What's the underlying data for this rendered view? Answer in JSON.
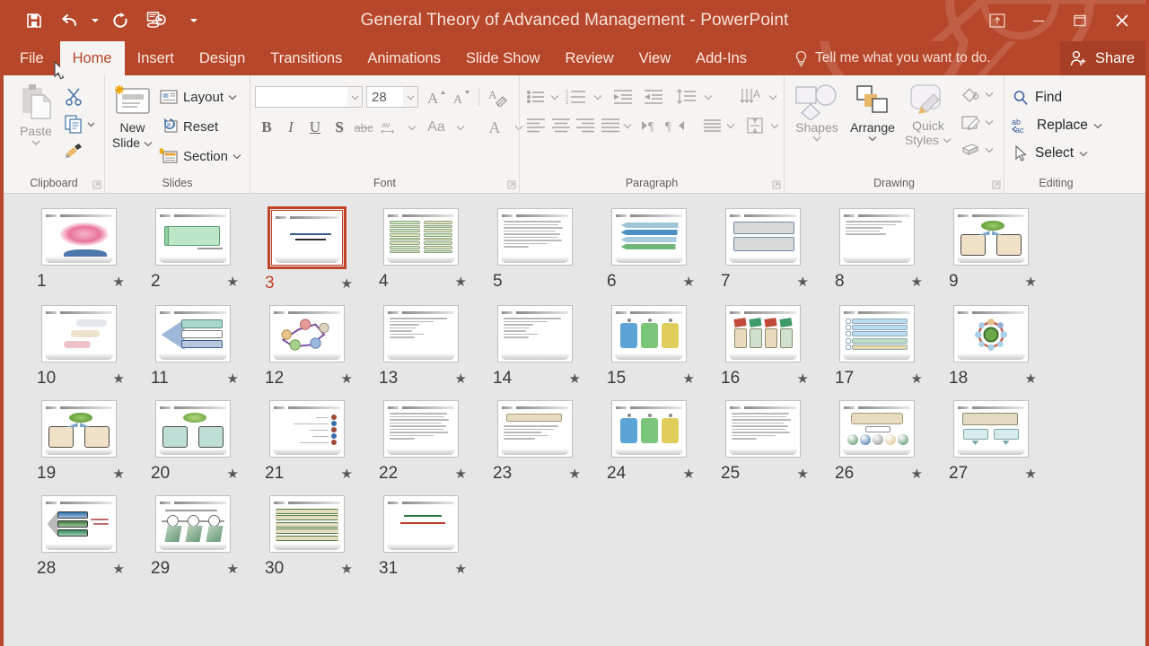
{
  "window": {
    "title": "General Theory of Advanced Management - PowerPoint",
    "accent_color": "#b7472a",
    "ribbon_bg": "#f5f4f2",
    "selection_color": "#c0442a"
  },
  "quick_access": [
    {
      "name": "save-icon",
      "label": "Save"
    },
    {
      "name": "undo-icon",
      "label": "Undo"
    },
    {
      "name": "redo-icon",
      "label": "Redo"
    },
    {
      "name": "start-presentation-icon",
      "label": "Start From Beginning"
    },
    {
      "name": "customize-qat-icon",
      "label": "Customize Quick Access Toolbar"
    }
  ],
  "window_controls": [
    {
      "name": "ribbon-display-options-icon",
      "label": "Ribbon Display Options"
    },
    {
      "name": "minimize-icon",
      "label": "Minimize"
    },
    {
      "name": "restore-icon",
      "label": "Restore Down"
    },
    {
      "name": "close-icon",
      "label": "Close"
    }
  ],
  "tabs": [
    {
      "label": "File",
      "active": false
    },
    {
      "label": "Home",
      "active": true
    },
    {
      "label": "Insert",
      "active": false
    },
    {
      "label": "Design",
      "active": false
    },
    {
      "label": "Transitions",
      "active": false
    },
    {
      "label": "Animations",
      "active": false
    },
    {
      "label": "Slide Show",
      "active": false
    },
    {
      "label": "Review",
      "active": false
    },
    {
      "label": "View",
      "active": false
    },
    {
      "label": "Add-Ins",
      "active": false
    }
  ],
  "tellme": {
    "placeholder": "Tell me what you want to do."
  },
  "share": {
    "label": "Share"
  },
  "ribbon": {
    "clipboard": {
      "group_label": "Clipboard",
      "paste_label": "Paste",
      "cut_label": "Cut",
      "copy_label": "Copy",
      "format_painter_label": "Format Painter"
    },
    "slides": {
      "group_label": "Slides",
      "new_slide_line1": "New",
      "new_slide_line2": "Slide",
      "layout_label": "Layout",
      "reset_label": "Reset",
      "section_label": "Section"
    },
    "font": {
      "group_label": "Font",
      "font_name_value": "",
      "font_size_value": "28",
      "bold_label": "B",
      "italic_label": "I",
      "underline_label": "U",
      "shadow_label": "S",
      "strikethrough_label": "abc",
      "spacing_label": "AV",
      "change_case_label": "Aa",
      "font_color_label": "A",
      "clear_formatting_label": "Clear All Formatting"
    },
    "paragraph": {
      "group_label": "Paragraph",
      "bullets_label": "Bullets",
      "numbering_label": "Numbering",
      "decrease_indent_label": "Decrease List Level",
      "increase_indent_label": "Increase List Level",
      "line_spacing_label": "Line Spacing",
      "align_left_label": "Align Left",
      "center_label": "Center",
      "align_right_label": "Align Right",
      "justify_label": "Justify",
      "ltr_label": "Left-to-Right",
      "rtl_label": "Right-to-Left",
      "columns_label": "Columns",
      "text_direction_label": "Text Direction",
      "align_text_label": "Align Text",
      "smartart_label": "Convert to SmartArt"
    },
    "drawing": {
      "group_label": "Drawing",
      "shapes_label": "Shapes",
      "arrange_label": "Arrange",
      "quick_styles_line1": "Quick",
      "quick_styles_line2": "Styles",
      "shape_fill_label": "Shape Fill",
      "shape_outline_label": "Shape Outline",
      "shape_effects_label": "Shape Effects"
    },
    "editing": {
      "group_label": "Editing",
      "find_label": "Find",
      "replace_label": "Replace",
      "select_label": "Select"
    }
  },
  "sorter": {
    "selected_slide": 3,
    "slides": [
      {
        "n": "1",
        "star": true,
        "kind": "calligraphy"
      },
      {
        "n": "2",
        "star": true,
        "kind": "green-banner"
      },
      {
        "n": "3",
        "star": true,
        "kind": "title-only",
        "selected": true
      },
      {
        "n": "4",
        "star": true,
        "kind": "two-tables"
      },
      {
        "n": "5",
        "star": false,
        "kind": "text-para"
      },
      {
        "n": "6",
        "star": true,
        "kind": "arrows-stack"
      },
      {
        "n": "7",
        "star": true,
        "kind": "two-boxes"
      },
      {
        "n": "8",
        "star": true,
        "kind": "text-lines"
      },
      {
        "n": "9",
        "star": true,
        "kind": "green-oval-two"
      },
      {
        "n": "10",
        "star": true,
        "kind": "pills"
      },
      {
        "n": "11",
        "star": true,
        "kind": "big-arrow"
      },
      {
        "n": "12",
        "star": true,
        "kind": "network"
      },
      {
        "n": "13",
        "star": true,
        "kind": "text-list"
      },
      {
        "n": "14",
        "star": true,
        "kind": "text-list"
      },
      {
        "n": "15",
        "star": true,
        "kind": "three-tags"
      },
      {
        "n": "16",
        "star": true,
        "kind": "four-cards"
      },
      {
        "n": "17",
        "star": true,
        "kind": "color-rows"
      },
      {
        "n": "18",
        "star": true,
        "kind": "radial"
      },
      {
        "n": "19",
        "star": true,
        "kind": "green-oval-two"
      },
      {
        "n": "20",
        "star": true,
        "kind": "green-oval-two-teal"
      },
      {
        "n": "21",
        "star": true,
        "kind": "bullet-dots"
      },
      {
        "n": "22",
        "star": true,
        "kind": "text-para"
      },
      {
        "n": "23",
        "star": true,
        "kind": "tan-banner"
      },
      {
        "n": "24",
        "star": true,
        "kind": "three-tags"
      },
      {
        "n": "25",
        "star": true,
        "kind": "text-para"
      },
      {
        "n": "26",
        "star": true,
        "kind": "spheres"
      },
      {
        "n": "27",
        "star": true,
        "kind": "flow-two"
      },
      {
        "n": "28",
        "star": true,
        "kind": "arrow-bars"
      },
      {
        "n": "29",
        "star": true,
        "kind": "three-pins"
      },
      {
        "n": "30",
        "star": true,
        "kind": "tan-rows"
      },
      {
        "n": "31",
        "star": true,
        "kind": "title-green-red"
      }
    ]
  }
}
